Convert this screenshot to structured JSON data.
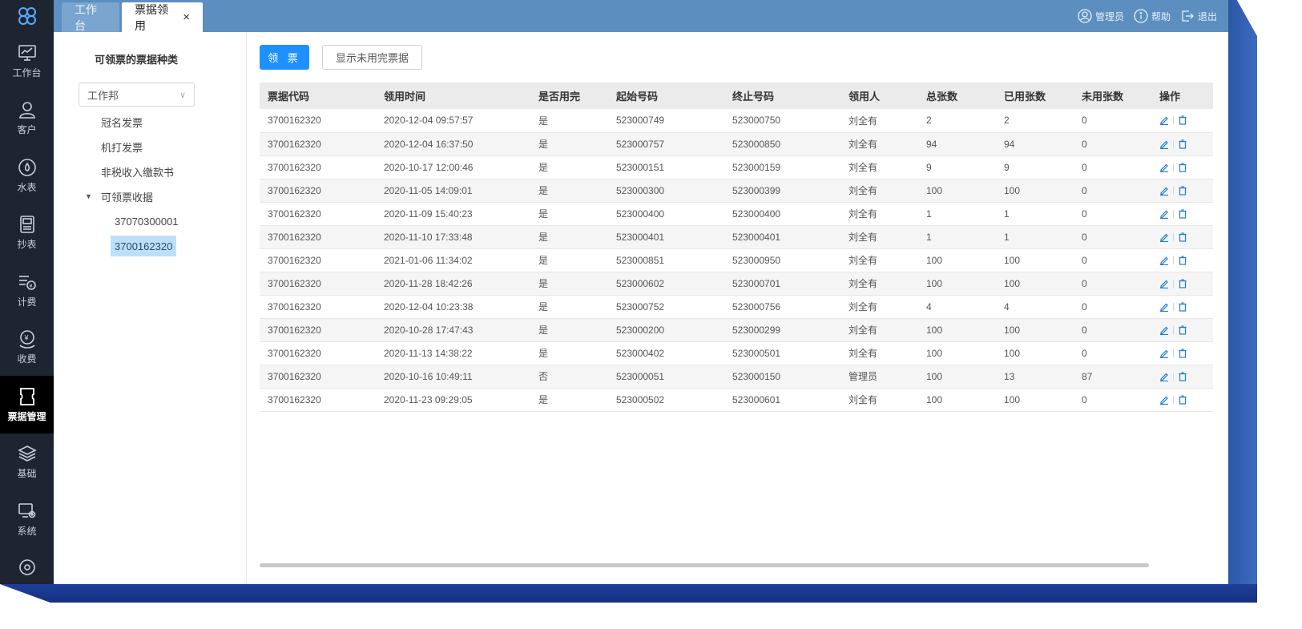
{
  "sidebar": {
    "items": [
      {
        "label": "工作台",
        "icon": "monitor-chart-icon"
      },
      {
        "label": "客户",
        "icon": "user-icon"
      },
      {
        "label": "水表",
        "icon": "water-meter-icon"
      },
      {
        "label": "抄表",
        "icon": "meter-reader-icon"
      },
      {
        "label": "计费",
        "icon": "billing-icon"
      },
      {
        "label": "收费",
        "icon": "payment-icon"
      },
      {
        "label": "票据管理",
        "icon": "ticket-icon",
        "active": true
      },
      {
        "label": "基础",
        "icon": "layers-icon"
      },
      {
        "label": "系统",
        "icon": "system-settings-icon"
      }
    ]
  },
  "tabs": {
    "work": "工作台",
    "bill": "票据领用",
    "close": "×"
  },
  "top": {
    "admin": "管理员",
    "help": "帮助",
    "logout": "退出"
  },
  "left": {
    "title": "可领票的票据种类",
    "select_value": "工作邦",
    "tree": {
      "n1": "冠名发票",
      "n2": "机打发票",
      "n3": "非税收入缴款书",
      "n4": "可领票收据",
      "n5": "37070300001",
      "n6": "3700162320"
    }
  },
  "toolbar": {
    "take": "领 票",
    "show_unfinished": "显示未用完票据"
  },
  "table": {
    "headers": [
      "票据代码",
      "领用时间",
      "是否用完",
      "起始号码",
      "终止号码",
      "领用人",
      "总张数",
      "已用张数",
      "未用张数",
      "操作"
    ],
    "rows": [
      [
        "3700162320",
        "2020-12-04 09:57:57",
        "是",
        "523000749",
        "523000750",
        "刘全有",
        "2",
        "2",
        "0"
      ],
      [
        "3700162320",
        "2020-12-04 16:37:50",
        "是",
        "523000757",
        "523000850",
        "刘全有",
        "94",
        "94",
        "0"
      ],
      [
        "3700162320",
        "2020-10-17 12:00:46",
        "是",
        "523000151",
        "523000159",
        "刘全有",
        "9",
        "9",
        "0"
      ],
      [
        "3700162320",
        "2020-11-05 14:09:01",
        "是",
        "523000300",
        "523000399",
        "刘全有",
        "100",
        "100",
        "0"
      ],
      [
        "3700162320",
        "2020-11-09 15:40:23",
        "是",
        "523000400",
        "523000400",
        "刘全有",
        "1",
        "1",
        "0"
      ],
      [
        "3700162320",
        "2020-11-10 17:33:48",
        "是",
        "523000401",
        "523000401",
        "刘全有",
        "1",
        "1",
        "0"
      ],
      [
        "3700162320",
        "2021-01-06 11:34:02",
        "是",
        "523000851",
        "523000950",
        "刘全有",
        "100",
        "100",
        "0"
      ],
      [
        "3700162320",
        "2020-11-28 18:42:26",
        "是",
        "523000602",
        "523000701",
        "刘全有",
        "100",
        "100",
        "0"
      ],
      [
        "3700162320",
        "2020-12-04 10:23:38",
        "是",
        "523000752",
        "523000756",
        "刘全有",
        "4",
        "4",
        "0"
      ],
      [
        "3700162320",
        "2020-10-28 17:47:43",
        "是",
        "523000200",
        "523000299",
        "刘全有",
        "100",
        "100",
        "0"
      ],
      [
        "3700162320",
        "2020-11-13 14:38:22",
        "是",
        "523000402",
        "523000501",
        "刘全有",
        "100",
        "100",
        "0"
      ],
      [
        "3700162320",
        "2020-10-16 10:49:11",
        "否",
        "523000051",
        "523000150",
        "管理员",
        "100",
        "13",
        "87"
      ],
      [
        "3700162320",
        "2020-11-23 09:29:05",
        "是",
        "523000502",
        "523000601",
        "刘全有",
        "100",
        "100",
        "0"
      ]
    ]
  },
  "colors": {
    "sidebar_bg": "#1e2430",
    "topbar_bg": "#5c8fc0",
    "primary": "#1e90ff",
    "selected_bg": "#bde0f8"
  }
}
